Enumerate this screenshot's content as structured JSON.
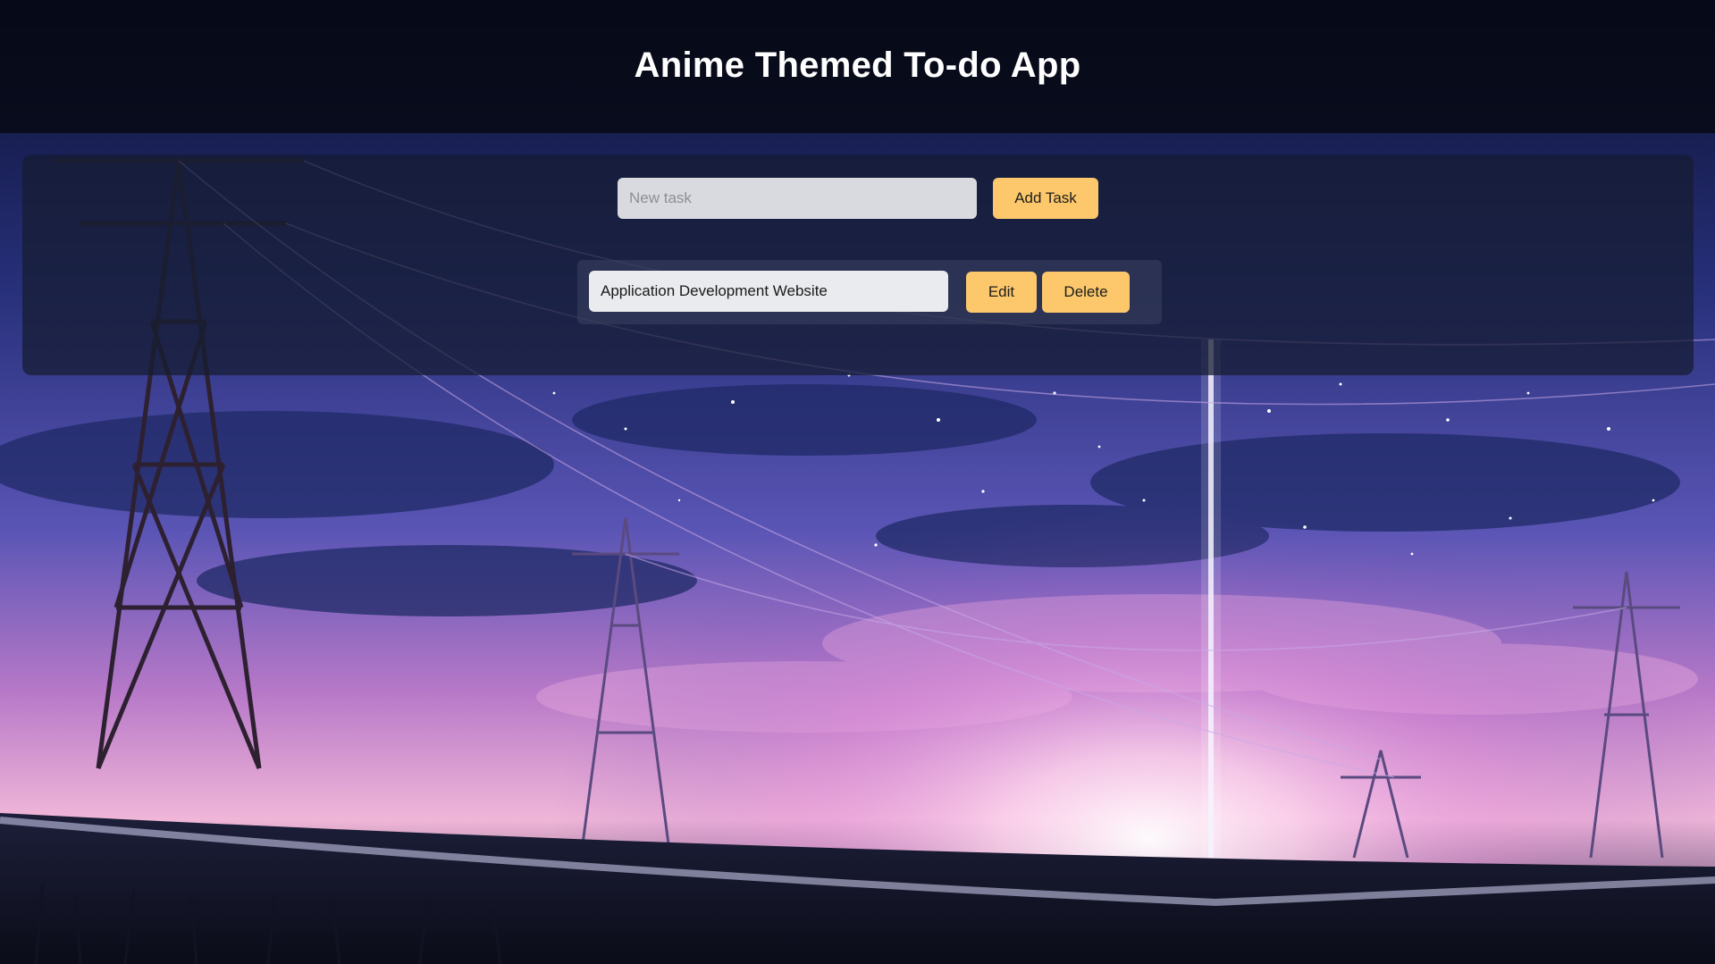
{
  "header": {
    "title": "Anime Themed To-do App"
  },
  "new_task": {
    "placeholder": "New task",
    "value": "",
    "add_label": "Add Task"
  },
  "tasks": [
    {
      "text": "Application Development Website",
      "edit_label": "Edit",
      "delete_label": "Delete"
    }
  ],
  "theme": {
    "accent": "#fcc86b",
    "header_bg": "#060914",
    "panel_bg": "#161c32"
  }
}
